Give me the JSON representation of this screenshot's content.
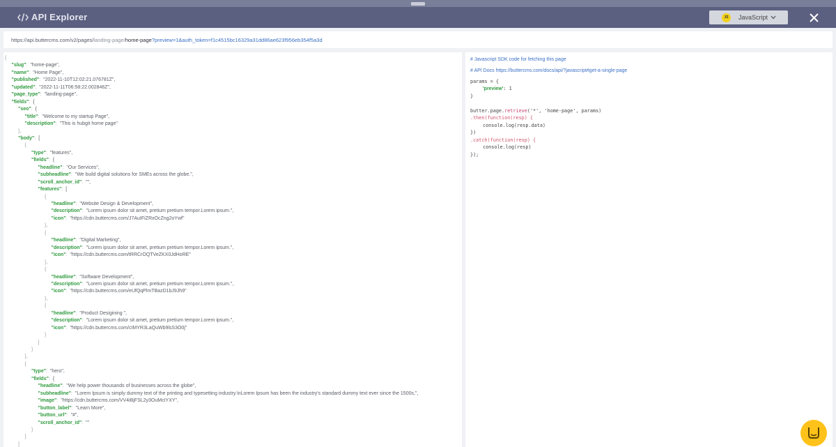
{
  "window": {
    "title": "API Explorer",
    "language_badge": "JS",
    "language": "JavaScript"
  },
  "url": {
    "base": "https://api.buttercms.com/v2/pages/",
    "page_type": "landing-page/",
    "slug": "home-page",
    "query": "?preview=1&auth_token=f1c4515bc16329a31dd86ae623f956eb354f5a3d"
  },
  "json_lines": [
    {
      "indent": 0,
      "punct": "{"
    },
    {
      "indent": 1,
      "key": "\"slug\"",
      "value": "\"home-page\","
    },
    {
      "indent": 1,
      "key": "\"name\"",
      "value": "\"Home Page\","
    },
    {
      "indent": 1,
      "key": "\"published\"",
      "value": "\"2022-11-10T12:02:21.076781Z\","
    },
    {
      "indent": 1,
      "key": "\"updated\"",
      "value": "\"2022-11-11T06:58:22.002846Z\","
    },
    {
      "indent": 1,
      "key": "\"page_type\"",
      "value": "\"landing-page\","
    },
    {
      "indent": 1,
      "key": "\"fields\"",
      "value": "{"
    },
    {
      "indent": 2,
      "key": "\"seo\"",
      "value": "{"
    },
    {
      "indent": 3,
      "key": "\"title\"",
      "value": "\"Welcome to my startup Page\","
    },
    {
      "indent": 3,
      "key": "\"description\"",
      "value": "\"This is hubgit home page\""
    },
    {
      "indent": 2,
      "punct": "},"
    },
    {
      "indent": 2,
      "key": "\"body\"",
      "value": "["
    },
    {
      "indent": 3,
      "punct": "{"
    },
    {
      "indent": 4,
      "key": "\"type\"",
      "value": "\"features\","
    },
    {
      "indent": 4,
      "key": "\"fields\"",
      "value": "{"
    },
    {
      "indent": 5,
      "key": "\"headline\"",
      "value": "\"Our Services\","
    },
    {
      "indent": 5,
      "key": "\"subheadline\"",
      "value": "\"We build digital solutions for SMEs across the globe.\","
    },
    {
      "indent": 5,
      "key": "\"scroll_anchor_id\"",
      "value": "\"\","
    },
    {
      "indent": 5,
      "key": "\"features\"",
      "value": "["
    },
    {
      "indent": 6,
      "punct": "{"
    },
    {
      "indent": 7,
      "key": "\"headline\"",
      "value": "\"Website Design & Development\","
    },
    {
      "indent": 7,
      "key": "\"description\"",
      "value": "\"Lorem ipsum dolor sit amet, pretium pretium tempor.Lorem ipsum.\","
    },
    {
      "indent": 7,
      "key": "\"icon\"",
      "value": "\"https://cdn.buttercms.com/J7AuIFiZRxOcZng2oYwf\""
    },
    {
      "indent": 6,
      "punct": "},"
    },
    {
      "indent": 6,
      "punct": "{"
    },
    {
      "indent": 7,
      "key": "\"headline\"",
      "value": "\"Digital Marketing\","
    },
    {
      "indent": 7,
      "key": "\"description\"",
      "value": "\"Lorem ipsum dolor sit amet, pretium pretium tempor.Lorem ipsum.\","
    },
    {
      "indent": 7,
      "key": "\"icon\"",
      "value": "\"https://cdn.buttercms.com/tRRCrOQTVeZKX0JdHoRE\""
    },
    {
      "indent": 6,
      "punct": "},"
    },
    {
      "indent": 6,
      "punct": "{"
    },
    {
      "indent": 7,
      "key": "\"headline\"",
      "value": "\"Software Development\","
    },
    {
      "indent": 7,
      "key": "\"description\"",
      "value": "\"Lorem ipsum dolor sit amet, pretium pretium tempor.Lorem ipsum.\","
    },
    {
      "indent": 7,
      "key": "\"icon\"",
      "value": "\"https://cdn.buttercms.com/eUfQqPlmTBazD1bJ9Jh9\""
    },
    {
      "indent": 6,
      "punct": "},"
    },
    {
      "indent": 6,
      "punct": "{"
    },
    {
      "indent": 7,
      "key": "\"headline\"",
      "value": "\"Product Desigining \","
    },
    {
      "indent": 7,
      "key": "\"description\"",
      "value": "\"Lorem ipsum dolor sit amet, pretium pretium tempor.Lorem ipsum.\","
    },
    {
      "indent": 7,
      "key": "\"icon\"",
      "value": "\"https://cdn.buttercms.com/cIMYR3LaQuWb9lsS3O0j\""
    },
    {
      "indent": 6,
      "punct": "}"
    },
    {
      "indent": 5,
      "punct": "]"
    },
    {
      "indent": 4,
      "punct": "}"
    },
    {
      "indent": 3,
      "punct": "},"
    },
    {
      "indent": 3,
      "punct": "{"
    },
    {
      "indent": 4,
      "key": "\"type\"",
      "value": "\"hero\","
    },
    {
      "indent": 4,
      "key": "\"fields\"",
      "value": "{"
    },
    {
      "indent": 5,
      "key": "\"headline\"",
      "value": "\"We help power thousands of businesses across the globe\","
    },
    {
      "indent": 5,
      "key": "\"subheadline\"",
      "value": "\"Lorem Ipsum is simply dummy text of the printing and typesetting industry.\\nLorem Ipsum has been the industry's standard dummy text ever since the 1500s,\","
    },
    {
      "indent": 5,
      "key": "\"image\"",
      "value": "\"https://cdn.buttercms.com/VV4iBjFSL2y3OuMcIYXY\","
    },
    {
      "indent": 5,
      "key": "\"button_label\"",
      "value": "\"Learn More\","
    },
    {
      "indent": 5,
      "key": "\"button_url\"",
      "value": "\"#\","
    },
    {
      "indent": 5,
      "key": "\"scroll_anchor_id\"",
      "value": "\"\""
    },
    {
      "indent": 4,
      "punct": "}"
    },
    {
      "indent": 3,
      "punct": "}"
    },
    {
      "indent": 2,
      "punct": "]"
    }
  ],
  "code": {
    "comment_1": "# Javascript SDK code for fetching this page",
    "comment_2": "# API Docs https://buttercms.com/docs/api/?javascript#get-a-single-page",
    "params_open": "params = {",
    "preview_key": "'preview'",
    "preview_value": ": 1",
    "params_close": "}",
    "retrieve_obj": "butter.page.",
    "retrieve_fn": "retrieve",
    "retrieve_args": "('*', 'home-page', params)",
    "then_line": ".then(function(resp) {",
    "then_body": "console.log(resp.data)",
    "then_close": "})",
    "catch_line": ".catch(function(resp) {",
    "catch_body": "console.log(resp)",
    "catch_close": "});"
  }
}
